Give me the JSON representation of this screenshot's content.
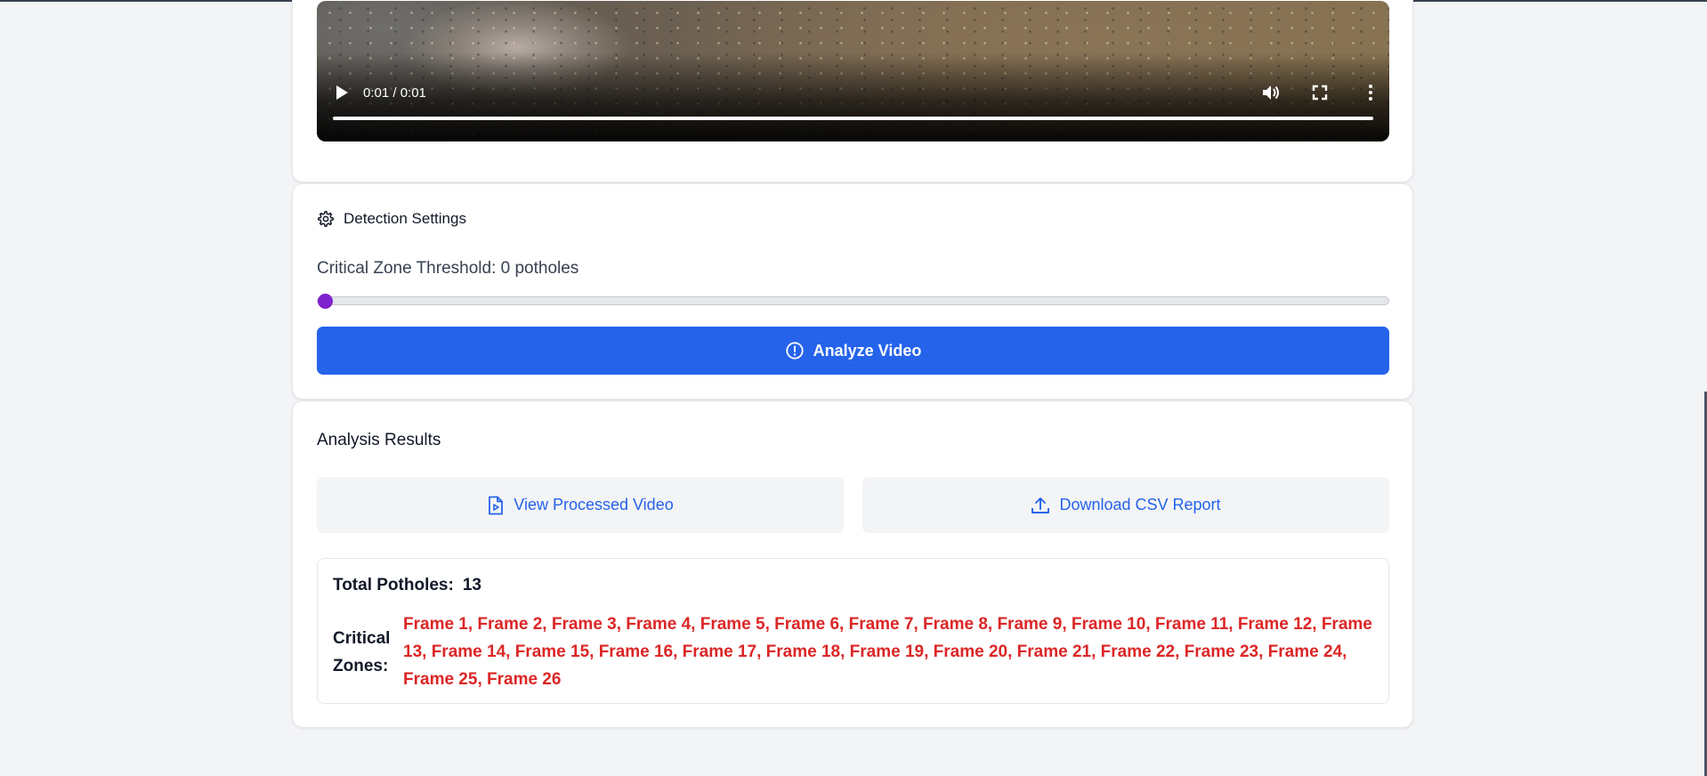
{
  "video": {
    "time_display": "0:01 / 0:01",
    "progress_fraction": 1.0,
    "controls": [
      "play-icon",
      "volume-icon",
      "fullscreen-icon",
      "more-options-icon"
    ]
  },
  "settings": {
    "title": "Detection Settings",
    "threshold_label": "Critical Zone Threshold: 0 potholes",
    "threshold_value": 0,
    "analyze_label": "Analyze Video",
    "icons": {
      "settings": "gear-icon",
      "analyze": "alert-circle-icon"
    }
  },
  "results": {
    "title": "Analysis Results",
    "view_label": "View Processed Video",
    "download_label": "Download CSV Report",
    "total_label": "Total Potholes:",
    "total_value": "13",
    "zones_label": "Critical Zones:",
    "zones_value": "Frame 1, Frame 2, Frame 3, Frame 4, Frame 5, Frame 6, Frame 7, Frame 8, Frame 9, Frame 10, Frame 11, Frame 12, Frame 13, Frame 14, Frame 15, Frame 16, Frame 17, Frame 18, Frame 19, Frame 20, Frame 21, Frame 22, Frame 23, Frame 24, Frame 25, Frame 26",
    "icons": {
      "view": "video-file-icon",
      "download": "upload-icon"
    }
  },
  "colors": {
    "primary": "#2563eb",
    "critical": "#dc2626",
    "slider_thumb": "#7e22ce",
    "background": "#f3f4f6"
  }
}
